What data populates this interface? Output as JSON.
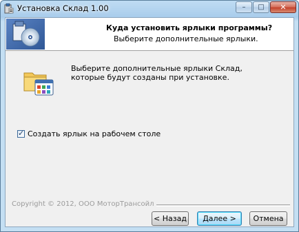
{
  "window": {
    "title": "Установка Склад 1.00",
    "controls": {
      "minimize": "–",
      "maximize": "□",
      "close": "✕"
    }
  },
  "header": {
    "title": "Куда установить ярлыки программы?",
    "subtitle": "Выберите дополнительные ярлыки."
  },
  "page": {
    "icon": "folder-with-shortcuts-icon",
    "description": "Выберите дополнительные ярлыки Склад, которые будут созданы при установке."
  },
  "options": {
    "desktop_shortcut": {
      "label": "Создать ярлык на рабочем столе",
      "checked": true
    }
  },
  "footer": {
    "copyright": "Copyright © 2012, ООО МоторТрансойл",
    "back_label": "< Назад",
    "next_label": "Далее >",
    "cancel_label": "Отмена"
  }
}
